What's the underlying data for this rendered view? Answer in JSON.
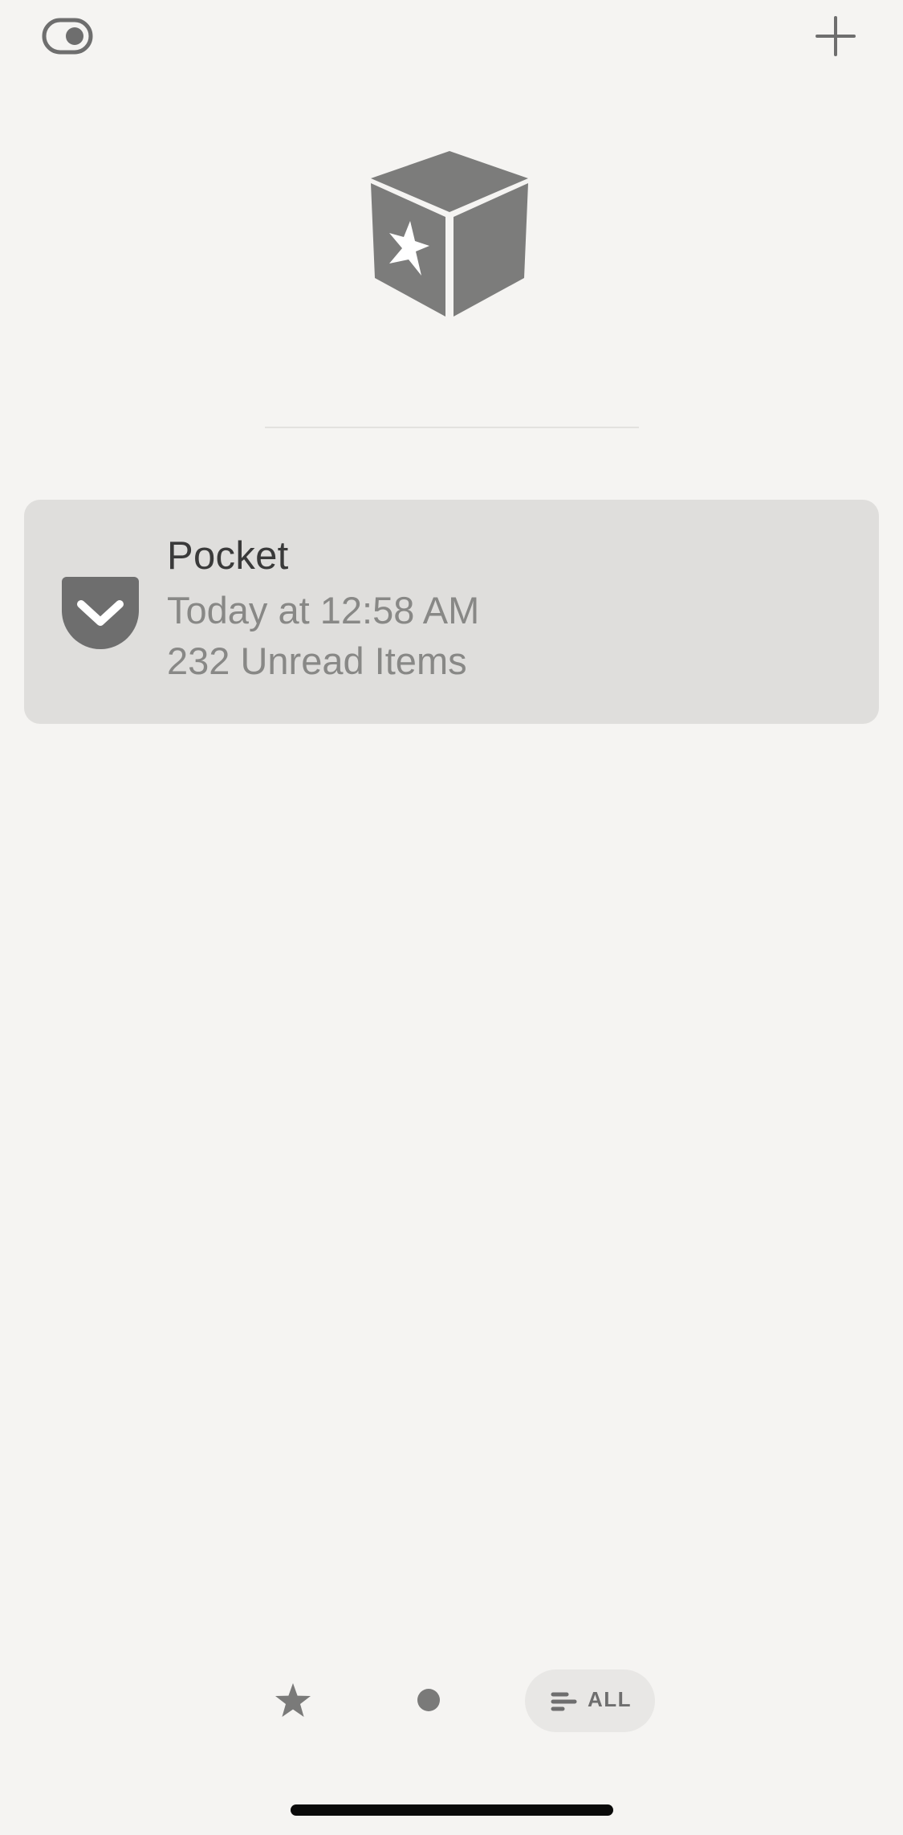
{
  "top_bar": {
    "left_icon": "toggle-icon",
    "right_icon": "plus-icon"
  },
  "logo": {
    "icon": "cube-star-icon"
  },
  "accounts": [
    {
      "icon": "pocket-icon",
      "name": "Pocket",
      "updated": "Today at 12:58 AM",
      "unread": "232 Unread Items"
    }
  ],
  "filter_bar": {
    "starred_icon": "star-icon",
    "unread_icon": "dot-icon",
    "all_icon": "list-lines-icon",
    "all_label": "ALL"
  },
  "colors": {
    "background": "#f5f4f2",
    "card": "#dfdedc",
    "icon_gray": "#6e6e6e",
    "secondary_text": "#888886"
  }
}
